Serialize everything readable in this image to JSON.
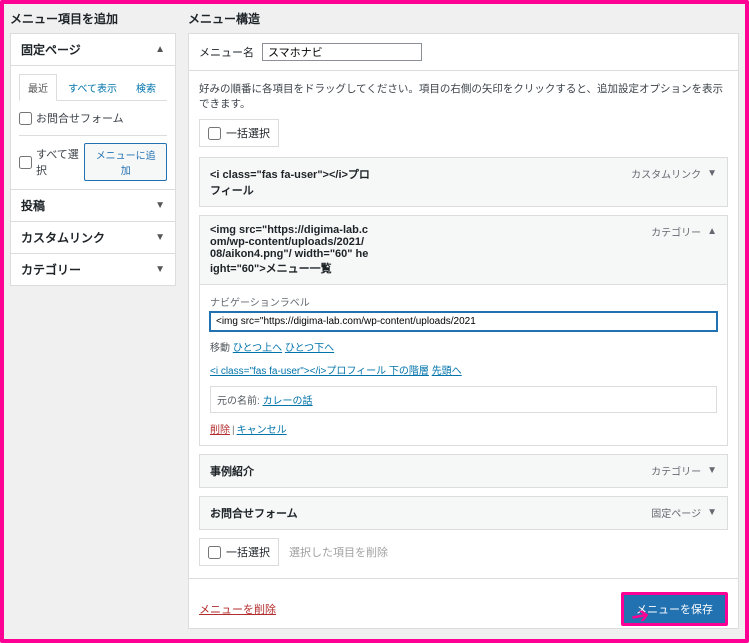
{
  "sidebar": {
    "heading": "メニュー項目を追加",
    "sections": [
      {
        "title": "固定ページ",
        "open": true
      },
      {
        "title": "投稿",
        "open": false
      },
      {
        "title": "カスタムリンク",
        "open": false
      },
      {
        "title": "カテゴリー",
        "open": false
      }
    ],
    "tabs": {
      "recent": "最近",
      "all": "すべて表示",
      "search": "検索"
    },
    "page_items": [
      "お問合せフォーム"
    ],
    "select_all": "すべて選択",
    "add_to_menu": "メニューに追加"
  },
  "main": {
    "heading": "メニュー構造",
    "menu_name_label": "メニュー名",
    "menu_name_value": "スマホナビ",
    "hint": "好みの順番に各項目をドラッグしてください。項目の右側の矢印をクリックすると、追加設定オプションを表示できます。",
    "bulk_select": "一括選択",
    "items": [
      {
        "title": "<i class=\"fas fa-user\"></i>プロフィール",
        "type": "カスタムリンク",
        "open": false
      },
      {
        "title": "<img src=\"https://digima-lab.com/wp-content/uploads/2021/08/aikon4.png\"/ width=\"60\" height=\"60\">メニュー一覧",
        "type": "カテゴリー",
        "open": true,
        "nav_label_caption": "ナビゲーションラベル",
        "nav_label_value": "<img src=\"https://digima-lab.com/wp-content/uploads/2021",
        "move_label": "移動",
        "move_up": "ひとつ上へ",
        "move_down": "ひとつ下へ",
        "move_under": "<i class=\"fas fa-user\"></i>プロフィール 下の階層",
        "move_top": "先頭へ",
        "orig_label": "元の名前:",
        "orig_value": "カレーの話",
        "remove": "削除",
        "cancel": "キャンセル"
      },
      {
        "title": "事例紹介",
        "type": "カテゴリー",
        "open": false
      },
      {
        "title": "お問合せフォーム",
        "type": "固定ページ",
        "open": false
      }
    ],
    "bulk_remove": "選択した項目を削除",
    "delete_menu": "メニューを削除",
    "save_menu": "メニューを保存"
  }
}
